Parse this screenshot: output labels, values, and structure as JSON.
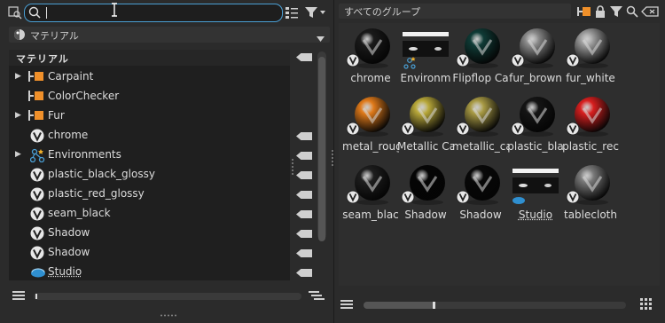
{
  "toolbar": {
    "search_value": "",
    "dropdown_label": "マテリアル",
    "group_search_placeholder": "すべてのグループ"
  },
  "tree": {
    "header": "マテリアル",
    "items": [
      {
        "label": "Carpaint",
        "type": "folder",
        "expandable": true
      },
      {
        "label": "ColorChecker",
        "type": "folder",
        "expandable": false
      },
      {
        "label": "Fur",
        "type": "folder",
        "expandable": true
      },
      {
        "label": "chrome",
        "type": "material",
        "expandable": false
      },
      {
        "label": "Environments",
        "type": "env",
        "expandable": true
      },
      {
        "label": "plastic_black_glossy",
        "type": "material",
        "expandable": false
      },
      {
        "label": "plastic_red_glossy",
        "type": "material",
        "expandable": false
      },
      {
        "label": "seam_black",
        "type": "material",
        "expandable": false
      },
      {
        "label": "Shadow",
        "type": "material",
        "expandable": false
      },
      {
        "label": "Shadow",
        "type": "material",
        "expandable": false
      },
      {
        "label": "Studio",
        "type": "studio",
        "expandable": false
      }
    ]
  },
  "grid": {
    "tiles": [
      {
        "label": "chrome",
        "ball": "#1a1a1a",
        "kind": "ball"
      },
      {
        "label": "Environm",
        "kind": "env"
      },
      {
        "label": "Flipflop Ca",
        "ball": "#0f3b36",
        "kind": "ball"
      },
      {
        "label": "fur_brown",
        "ball": "#8a8a8a",
        "kind": "ball"
      },
      {
        "label": "fur_white",
        "ball": "#9a9a9a",
        "kind": "ball"
      },
      {
        "label": "metal_roug",
        "ball": "#e07a1a",
        "kind": "ball"
      },
      {
        "label": "Metallic Ca",
        "ball": "#b8a83a",
        "kind": "ball"
      },
      {
        "label": "metallic_ca",
        "ball": "#a89a44",
        "kind": "ball"
      },
      {
        "label": "plastic_bla",
        "ball": "#151515",
        "kind": "ball"
      },
      {
        "label": "plastic_rec",
        "ball": "#d81f1f",
        "kind": "ball"
      },
      {
        "label": "seam_blac",
        "ball": "#1e1e1e",
        "kind": "ball"
      },
      {
        "label": "Shadow",
        "ball": "#050505",
        "kind": "ball"
      },
      {
        "label": "Shadow",
        "ball": "#080808",
        "kind": "ball"
      },
      {
        "label": "Studio",
        "kind": "studio"
      },
      {
        "label": "tablecloth",
        "ball": "#7a7a7a",
        "kind": "ball"
      }
    ]
  },
  "colors": {
    "accent": "#4a9fd4",
    "folder": "#f0902a"
  },
  "icons": {
    "toolbar_left": [
      "search-history-icon",
      "search-icon",
      "list-view-icon",
      "filter-icon"
    ],
    "toolbar_right": [
      "folder-icon",
      "lock-icon",
      "filter-icon",
      "search-icon",
      "clear-tag-icon"
    ]
  }
}
